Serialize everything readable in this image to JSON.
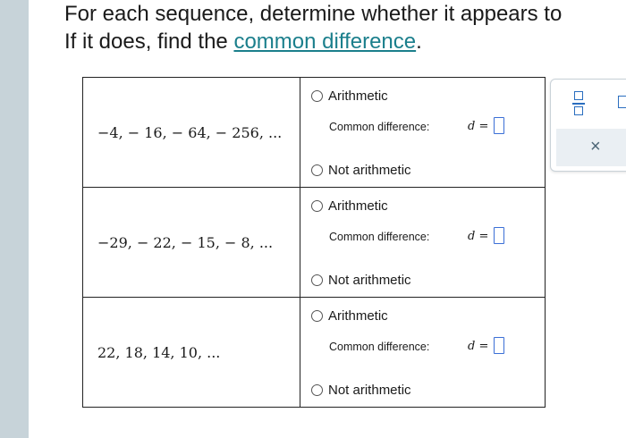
{
  "instructions": {
    "line1": "For each sequence, determine whether it appears to",
    "line2_prefix": "If it does, find the ",
    "line2_link": "common difference",
    "line2_suffix": "."
  },
  "rows": [
    {
      "sequence": "−4,  − 16,  − 64,  − 256, ...",
      "option_arithmetic": "Arithmetic",
      "common_difference_label": "Common difference:",
      "d_var": "d",
      "equals": "=",
      "option_not_arithmetic": "Not arithmetic"
    },
    {
      "sequence": "−29,  − 22,  − 15,  − 8, ...",
      "option_arithmetic": "Arithmetic",
      "common_difference_label": "Common difference:",
      "d_var": "d",
      "equals": "=",
      "option_not_arithmetic": "Not arithmetic"
    },
    {
      "sequence": "22,  18,  14,  10, ...",
      "option_arithmetic": "Arithmetic",
      "common_difference_label": "Common difference:",
      "d_var": "d",
      "equals": "=",
      "option_not_arithmetic": "Not arithmetic"
    }
  ],
  "toolbox": {
    "clear_glyph": "×",
    "fraction_icon": "fraction-icon",
    "box_icon": "box-icon"
  },
  "colors": {
    "link": "#1b7f8c",
    "answer_box": "#3b6fd6",
    "tool_icons": "#2a6ebf",
    "left_rail": "#c7d3d9"
  }
}
